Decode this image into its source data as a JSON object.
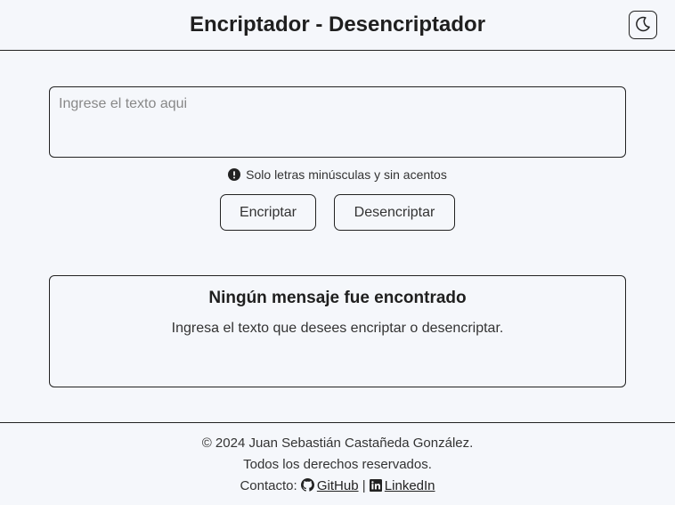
{
  "header": {
    "title": "Encriptador - Desencriptador",
    "theme_toggle_icon": "moon-icon"
  },
  "input": {
    "placeholder": "Ingrese el texto aqui",
    "value": ""
  },
  "hint": {
    "icon": "exclamation-circle-icon",
    "text": "Solo letras minúsculas y sin acentos"
  },
  "buttons": {
    "encrypt": "Encriptar",
    "decrypt": "Desencriptar"
  },
  "output": {
    "title": "Ningún mensaje fue encontrado",
    "message": "Ingresa el texto que desees encriptar o desencriptar."
  },
  "footer": {
    "copyright": "© 2024 Juan Sebastián Castañeda González.",
    "rights": "Todos los derechos reservados.",
    "contact_label": "Contacto:",
    "github_label": "GitHub",
    "separator": "|",
    "linkedin_label": "LinkedIn"
  }
}
